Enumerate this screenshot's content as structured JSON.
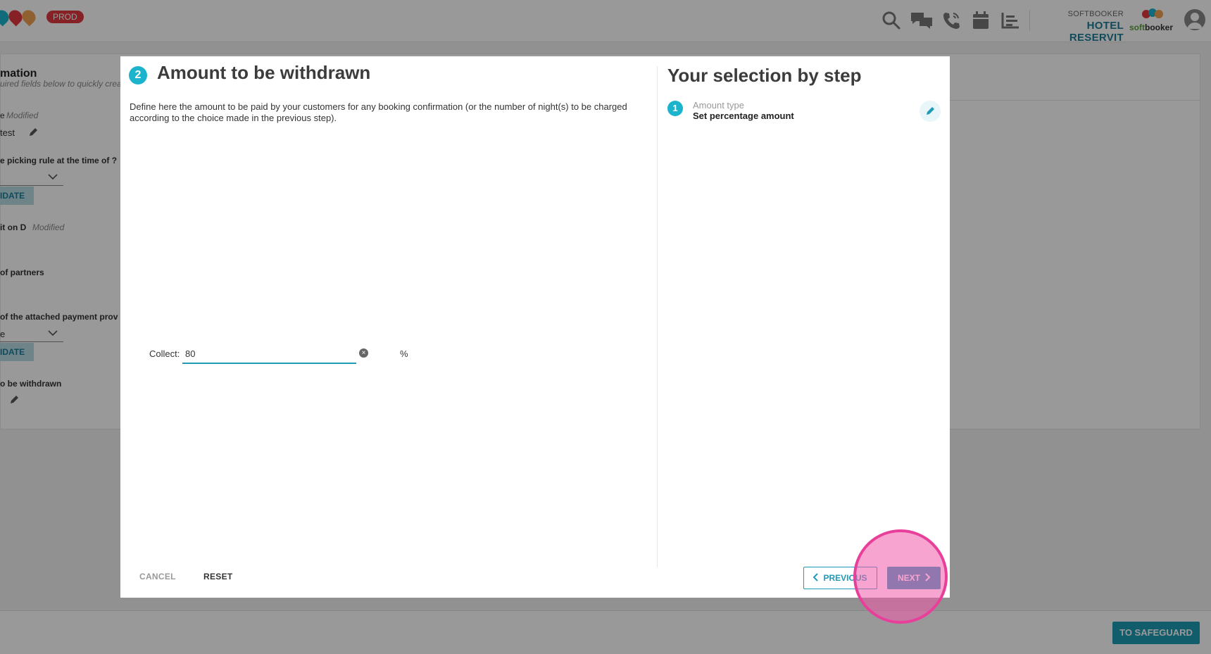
{
  "topbar": {
    "env_badge": "PROD",
    "hotel_group": "SOFTBOOKER",
    "hotel_name": "HOTEL RESERVIT",
    "brand_name_a": "soft",
    "brand_name_b": "booker",
    "icons": [
      "search-icon",
      "chat-icon",
      "phone-icon",
      "calendar-icon",
      "chart-icon",
      "user-icon"
    ]
  },
  "background": {
    "title": "mation",
    "subtitle": "uired fields below to quickly crea",
    "field1_label": "e",
    "field1_status": "Modified",
    "field1_value": "test",
    "field2_label": "e picking rule at the time of ?",
    "update_label": "IDATE",
    "field3_label": "it on D",
    "field3_status": "Modified",
    "field4_label": "of partners",
    "field4_value": "",
    "field5_label": "of the attached payment prov",
    "field5_value": "e",
    "field6_label": "o be withdrawn",
    "safeguard_label": "TO SAFEGUARD"
  },
  "modal": {
    "step_number": "2",
    "title": "Amount to be withdrawn",
    "description": "Define here the amount to be paid by your customers for any booking confirmation (or the number of night(s) to be charged according to the choice made in the previous step).",
    "collect_label": "Collect:",
    "collect_value": "80",
    "collect_unit": "%",
    "side_title": "Your selection by step",
    "steps": [
      {
        "number": "1",
        "label": "Amount type",
        "value": "Set percentage amount"
      }
    ],
    "cancel_label": "CANCEL",
    "reset_label": "RESET",
    "previous_label": "PREVIOUS",
    "next_label": "NEXT"
  },
  "colors": {
    "accent": "#1f9bb5",
    "step_badge": "#1bb4cc",
    "env_badge": "#e0393e",
    "hotel_name": "#1c7e9a",
    "highlight": "#e8409a"
  }
}
